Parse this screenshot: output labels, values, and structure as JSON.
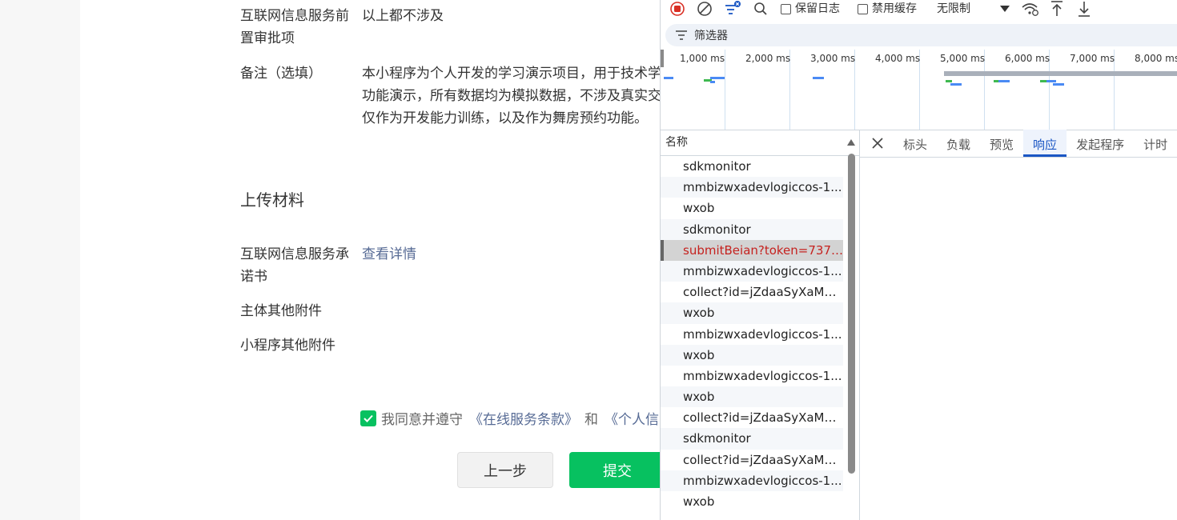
{
  "form": {
    "row1": {
      "label": "互联网信息服务前置审批项",
      "value": "以上都不涉及"
    },
    "row2": {
      "label": "备注（选填）",
      "value": "本小程序为个人开发的学习演示项目，用于技术学习与功能演示，所有数据均为模拟数据，不涉及真实交易，仅作为开发能力训练，以及作为舞房预约功能。"
    },
    "upload_title": "上传材料",
    "row3": {
      "label": "互联网信息服务承诺书",
      "value": "查看详情"
    },
    "row4": {
      "label": "主体其他附件"
    },
    "row5": {
      "label": "小程序其他附件"
    },
    "agree": {
      "prefix": "我同意并遵守",
      "link1": "《在线服务条款》",
      "and": "和",
      "link2": "《个人信"
    },
    "buttons": {
      "prev": "上一步",
      "submit": "提交"
    }
  },
  "devtools": {
    "toolbar": {
      "preserve_log": "保留日志",
      "disable_cache": "禁用缓存",
      "throttle": "无限制"
    },
    "filter": "筛选器",
    "timeline_ticks": [
      "1,000 ms",
      "2,000 ms",
      "3,000 ms",
      "4,000 ms",
      "5,000 ms",
      "6,000 ms",
      "7,000 ms",
      "8,000 ms"
    ],
    "name_header": "名称",
    "requests": [
      "sdkmonitor",
      "mmbizwxadevlogiccos-1...",
      "wxob",
      "sdkmonitor",
      "submitBeian?token=7373...",
      "mmbizwxadevlogiccos-1...",
      "collect?id=jZdaaSyXaMW...",
      "wxob",
      "mmbizwxadevlogiccos-1...",
      "wxob",
      "mmbizwxadevlogiccos-1...",
      "wxob",
      "collect?id=jZdaaSyXaMW...",
      "sdkmonitor",
      "collect?id=jZdaaSyXaMW...",
      "mmbizwxadevlogiccos-1...",
      "wxob"
    ],
    "tabs": [
      "标头",
      "负载",
      "预览",
      "响应",
      "发起程序",
      "计时"
    ],
    "active_tab": "响应"
  }
}
